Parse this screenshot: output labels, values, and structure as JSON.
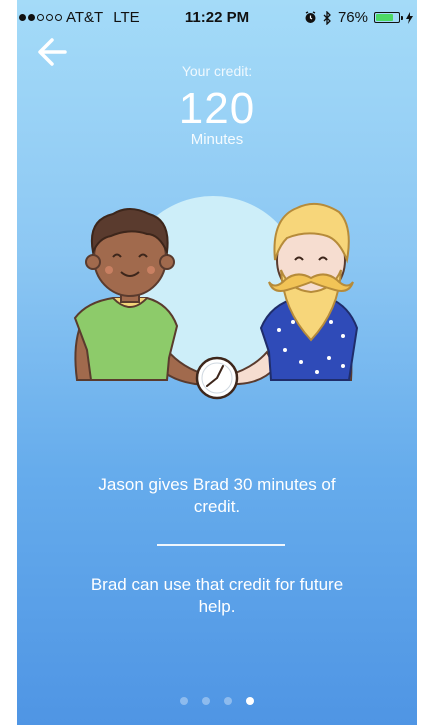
{
  "status_bar": {
    "carrier": "AT&T",
    "network": "LTE",
    "time": "11:22 PM",
    "battery": "76%",
    "battery_level": 0.76,
    "signal_bars": 2,
    "signal_total": 5,
    "icons": [
      "alarm-icon",
      "bluetooth-icon",
      "charging-icon"
    ]
  },
  "header": {
    "back_icon": "arrow-left-icon"
  },
  "credit": {
    "label": "Your credit:",
    "value": "120",
    "unit": "Minutes"
  },
  "illustration": {
    "left_person": "Jason",
    "right_person": "Brad",
    "object": "clock-icon"
  },
  "content": {
    "description_1": "Jason gives Brad 30 minutes of credit.",
    "description_2": "Brad can use that credit for future help."
  },
  "pager": {
    "total": 4,
    "active_index": 3
  },
  "colors": {
    "bg_top": "#a4dbf8",
    "bg_bottom": "#4f95e4",
    "battery": "#4cd964",
    "text": "#ffffff"
  }
}
